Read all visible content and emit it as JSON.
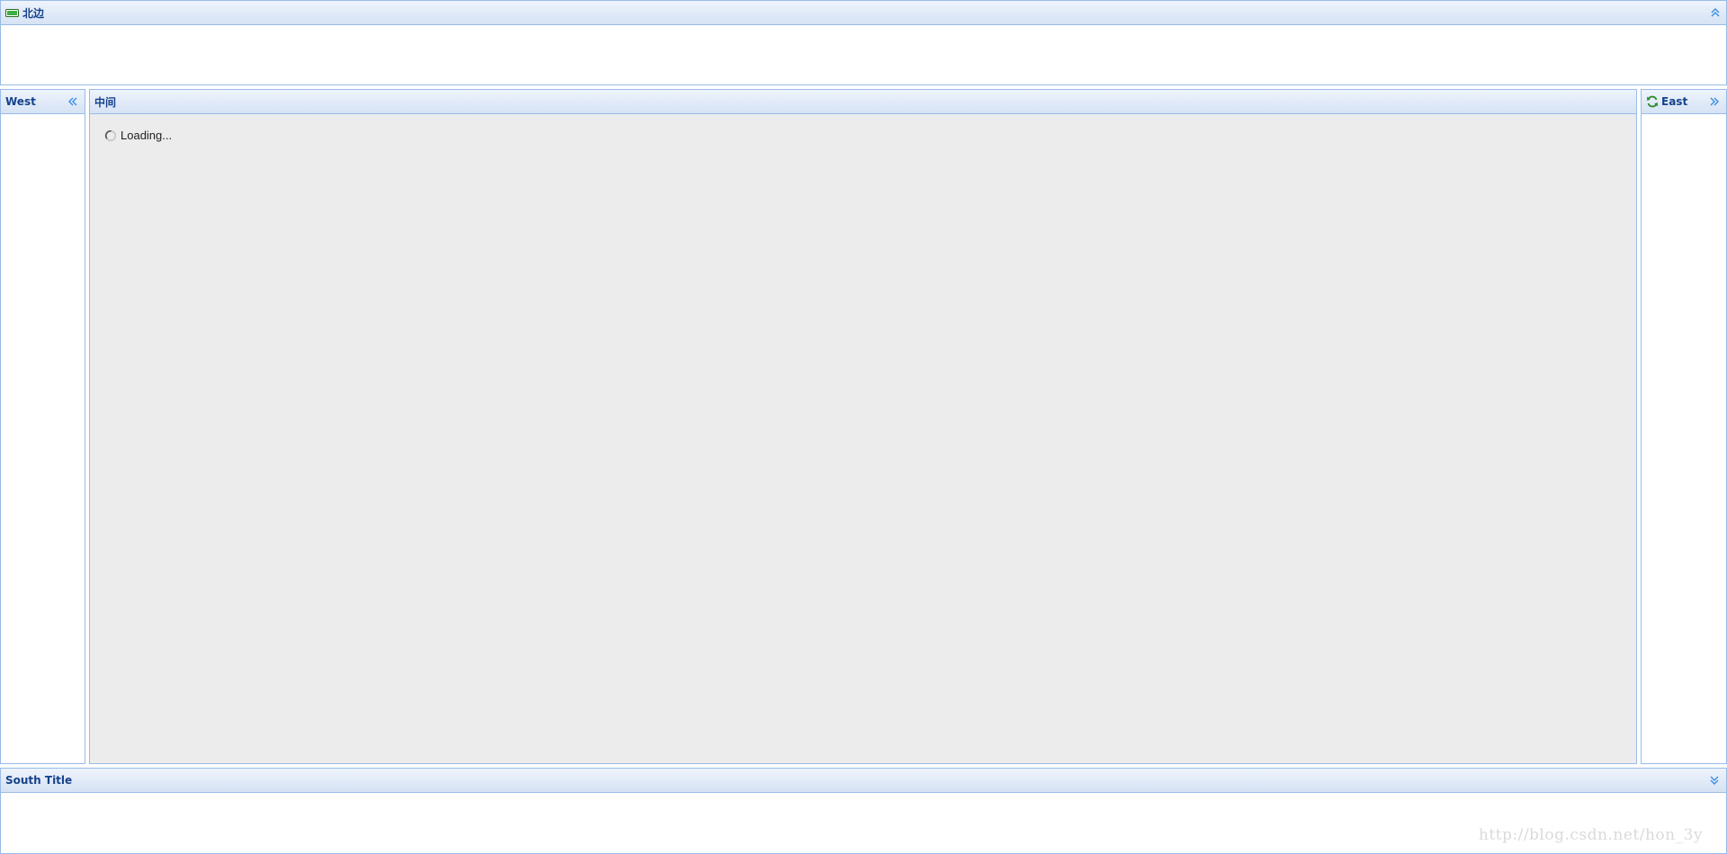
{
  "north": {
    "title": "北边",
    "title_icon": "battery-icon",
    "collapse_tool": "collapse-up-icon"
  },
  "west": {
    "title": "West",
    "collapse_tool": "collapse-left-icon"
  },
  "center": {
    "title": "中间",
    "loading_text": "Loading..."
  },
  "east": {
    "title": "East",
    "title_icon": "refresh-icon",
    "collapse_tool": "collapse-right-icon"
  },
  "south": {
    "title": "South Title",
    "collapse_tool": "collapse-down-icon"
  },
  "watermark": "http://blog.csdn.net/hon_3y",
  "colors": {
    "border": "#99bbe8",
    "header_text": "#15428b",
    "center_body": "#ececec",
    "tool_accent": "#3a8de0"
  }
}
